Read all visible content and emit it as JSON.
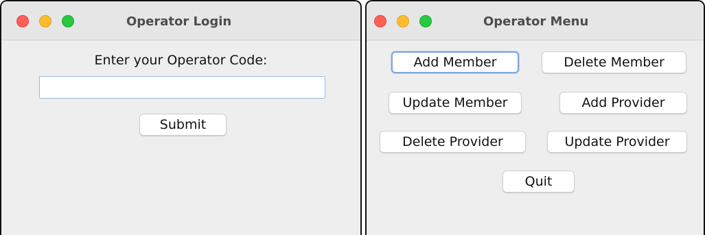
{
  "login_window": {
    "title": "Operator Login",
    "prompt": "Enter your Operator Code:",
    "code_input": {
      "value": "",
      "placeholder": ""
    },
    "submit_label": "Submit"
  },
  "menu_window": {
    "title": "Operator Menu",
    "buttons": {
      "add_member": "Add Member",
      "delete_member": "Delete Member",
      "update_member": "Update Member",
      "add_provider": "Add Provider",
      "delete_provider": "Delete Provider",
      "update_provider": "Update Provider",
      "quit": "Quit"
    }
  },
  "colors": {
    "close": "#fe5f57",
    "minimize": "#febc2e",
    "maximize": "#28c840",
    "focus_ring": "#7fa7e0"
  }
}
